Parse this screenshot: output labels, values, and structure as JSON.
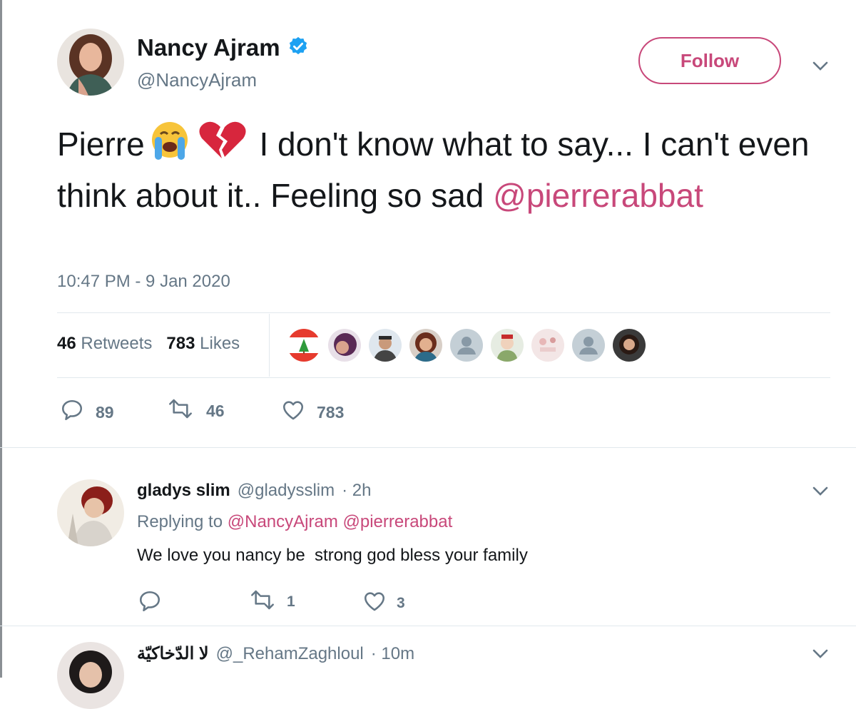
{
  "tweet": {
    "name": "Nancy Ajram",
    "handle": "@NancyAjram",
    "follow_label": "Follow",
    "text_part1": "Pierre",
    "text_part2": " I don't know what to say... I can't even think about it.. Feeling so sad ",
    "mention": "@pierrerabbat",
    "timestamp": "10:47 PM - 9 Jan 2020",
    "retweets_count": "46",
    "retweets_label": "Retweets",
    "likes_count": "783",
    "likes_label": "Likes",
    "reply_count": "89",
    "retweet_count": "46",
    "like_count": "783"
  },
  "replies": [
    {
      "name": "gladys slim",
      "handle": "@gladysslim",
      "time": "· 2h",
      "replying_label": "Replying to",
      "replying_to": "@NancyAjram @pierrerabbat",
      "text": "We love you nancy be  strong god bless your family",
      "reply_count": "",
      "retweet_count": "1",
      "like_count": "3"
    },
    {
      "name": "لا الدّخاكيّة",
      "handle": "@_RehamZaghloul",
      "time": "· 10m"
    }
  ],
  "icons": {
    "verified": "verified-badge-icon",
    "chevron": "chevron-down-icon",
    "reply": "reply-icon",
    "retweet": "retweet-icon",
    "like": "heart-icon"
  },
  "colors": {
    "accent": "#c8487a",
    "muted": "#657786",
    "verified": "#1da1f2"
  }
}
